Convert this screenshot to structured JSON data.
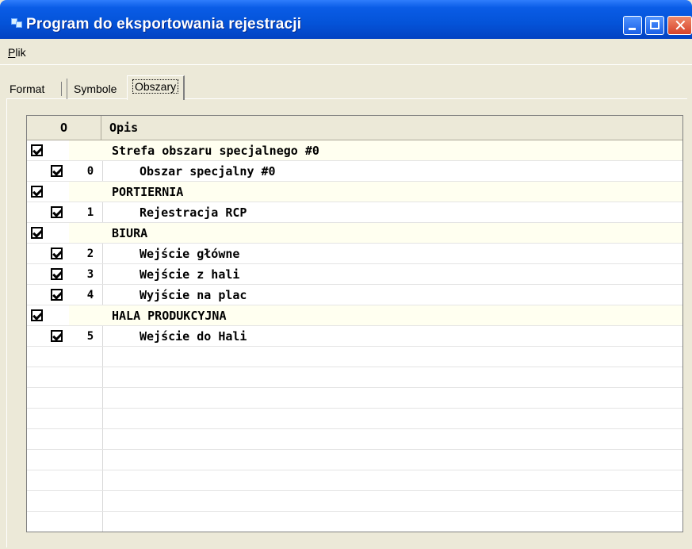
{
  "window": {
    "title": "Program do eksportowania rejestracji"
  },
  "menu": {
    "file": "Plik"
  },
  "tabs": [
    "Format",
    "Symbole",
    "Obszary"
  ],
  "table": {
    "headers": {
      "col1": "O",
      "col2": "Opis"
    },
    "rows": [
      {
        "type": "zone",
        "checked": true,
        "num": "",
        "text": "Strefa obszaru specjalnego #0"
      },
      {
        "type": "area",
        "checked": true,
        "num": "0",
        "text": "Obszar specjalny #0"
      },
      {
        "type": "zone",
        "checked": true,
        "num": "",
        "text": "PORTIERNIA"
      },
      {
        "type": "area",
        "checked": true,
        "num": "1",
        "text": "Rejestracja RCP"
      },
      {
        "type": "zone",
        "checked": true,
        "num": "",
        "text": "BIURA"
      },
      {
        "type": "area",
        "checked": true,
        "num": "2",
        "text": "Wejście główne"
      },
      {
        "type": "area",
        "checked": true,
        "num": "3",
        "text": "Wejście z hali"
      },
      {
        "type": "area",
        "checked": true,
        "num": "4",
        "text": "Wyjście na plac"
      },
      {
        "type": "zone",
        "checked": true,
        "num": "",
        "text": "HALA PRODUKCYJNA"
      },
      {
        "type": "area",
        "checked": true,
        "num": "5",
        "text": "Wejście do Hali"
      }
    ]
  }
}
